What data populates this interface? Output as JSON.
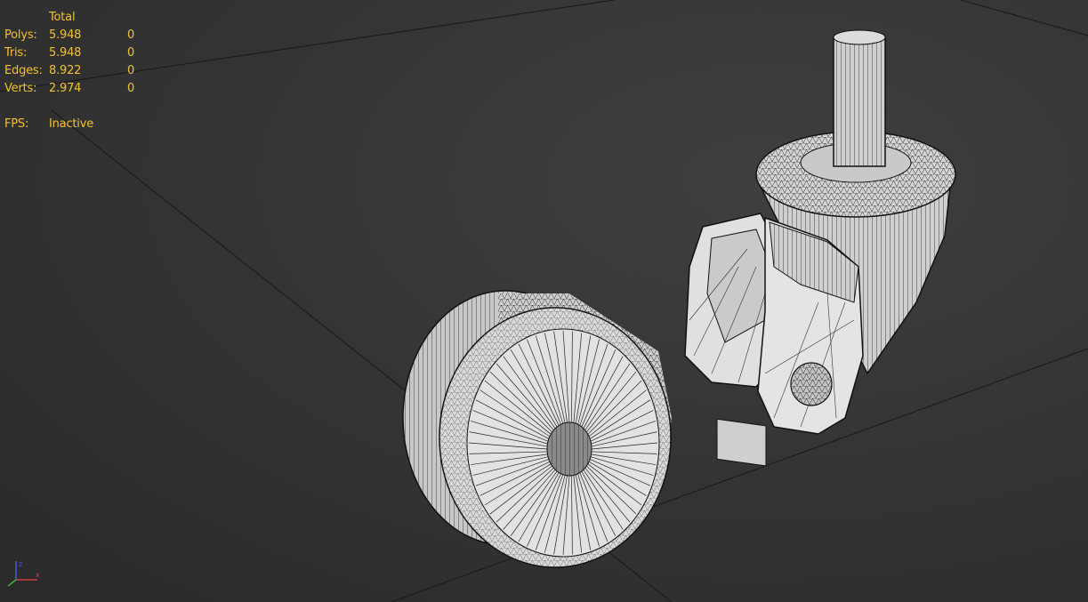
{
  "stats": {
    "header": "Total",
    "rows": [
      {
        "label": "Polys:",
        "total": "5.948",
        "selected": "0"
      },
      {
        "label": "Tris:",
        "total": "5.948",
        "selected": "0"
      },
      {
        "label": "Edges:",
        "total": "8.922",
        "selected": "0"
      },
      {
        "label": "Verts:",
        "total": "2.974",
        "selected": "0"
      }
    ],
    "fps_label": "FPS:",
    "fps_value": "Inactive"
  },
  "icons": {
    "axis_gizmo": "xyz-axis-icon"
  },
  "colors": {
    "viewport_bg": "#353535",
    "stats_text": "#f2c230",
    "model_fill": "#d4d4d4",
    "wire": "#111111",
    "grid": "#1a1a1a",
    "axis_x": "#d04040",
    "axis_y": "#40b040",
    "axis_z": "#4060e0"
  }
}
